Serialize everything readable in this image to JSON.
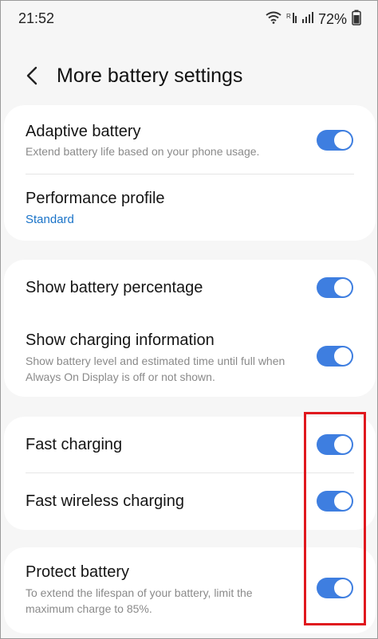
{
  "status_bar": {
    "time": "21:52",
    "battery": "72%",
    "icons": [
      "wifi-icon",
      "network-signal-icon",
      "cellular-signal-icon",
      "battery-icon"
    ]
  },
  "header": {
    "back_icon": "chevron-left-icon",
    "title": "More battery settings"
  },
  "groups": [
    {
      "items": [
        {
          "title": "Adaptive battery",
          "subtitle": "Extend battery life based on your phone usage.",
          "toggle": true
        },
        {
          "title": "Performance profile",
          "value": "Standard"
        }
      ]
    },
    {
      "items": [
        {
          "title": "Show battery percentage",
          "toggle": true
        },
        {
          "title": "Show charging information",
          "subtitle": "Show battery level and estimated time until full when Always On Display is off or not shown.",
          "toggle": true
        }
      ]
    },
    {
      "items": [
        {
          "title": "Fast charging",
          "toggle": true
        },
        {
          "title": "Fast wireless charging",
          "toggle": true
        }
      ]
    },
    {
      "items": [
        {
          "title": "Protect battery",
          "subtitle": "To extend the lifespan of your battery, limit the maximum charge to 85%.",
          "toggle": true
        }
      ]
    }
  ],
  "colors": {
    "toggle_on": "#3e7ee0",
    "link": "#1a73c8",
    "highlight": "#e0181e",
    "background": "#f6f6f6"
  }
}
